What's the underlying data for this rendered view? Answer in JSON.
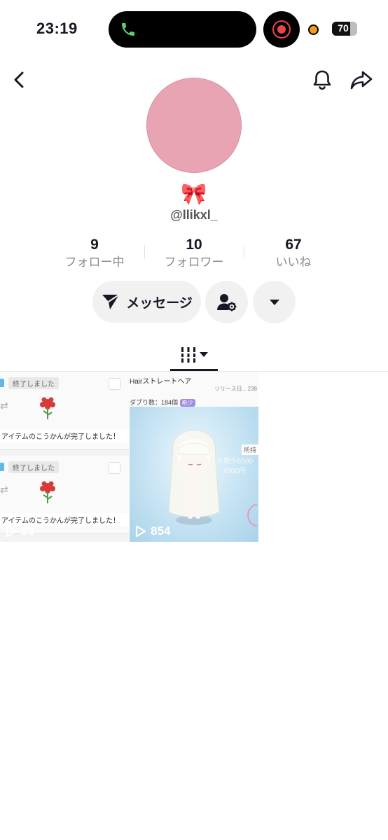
{
  "status_bar": {
    "time": "23:19",
    "battery": "70"
  },
  "profile": {
    "nickname": "🎀",
    "username": "@llikxl_",
    "avatar_color": "#e9a4b3"
  },
  "stats": [
    {
      "value": "9",
      "label": "フォロー中"
    },
    {
      "value": "10",
      "label": "フォロワー"
    },
    {
      "value": "67",
      "label": "いいね"
    }
  ],
  "actions": {
    "message_label": "メッセージ"
  },
  "videos": [
    {
      "plays": "33",
      "cards": [
        {
          "status": "終了しました",
          "message": "アイテムのこうかんが完了しました！"
        },
        {
          "status": "終了しました",
          "message": "アイテムのこうかんが完了しました！"
        }
      ]
    },
    {
      "plays": "854",
      "title": "Hairストレートヘア",
      "release": "リリース日…238",
      "duplicates": "ダブり数：184個",
      "rarity": "希少",
      "owned": "所持",
      "price_line1": "Ｒ希少6500",
      "price_line2": "4000円"
    }
  ],
  "icons": [
    "back-icon",
    "bell-icon",
    "share-icon",
    "send-icon",
    "add-user-settings-icon",
    "caret-down-icon",
    "grid-icon",
    "play-icon"
  ]
}
